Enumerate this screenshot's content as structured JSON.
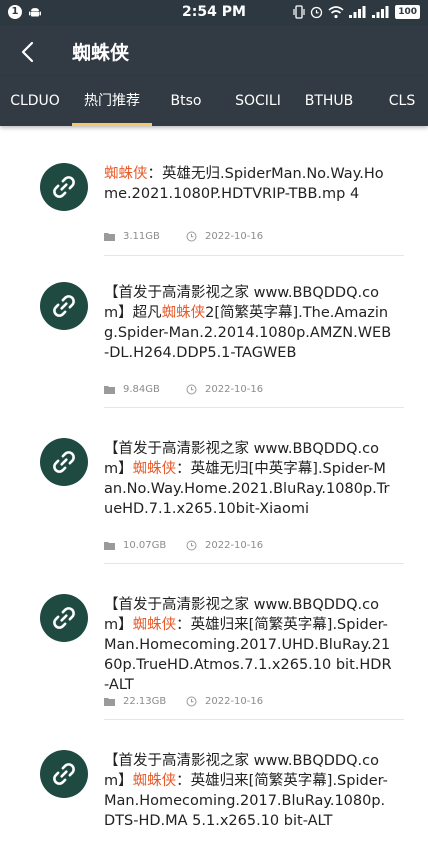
{
  "status_bar": {
    "notification_badge": "1",
    "time": "2:54 PM",
    "battery": "100"
  },
  "header": {
    "title": "蜘蛛侠"
  },
  "tabs": [
    {
      "label": "CLDUO"
    },
    {
      "label": "热门推荐"
    },
    {
      "label": "Btso"
    },
    {
      "label": "SOCILI"
    },
    {
      "label": "BTHUB"
    },
    {
      "label": "CLS"
    }
  ],
  "active_tab": "热门推荐",
  "colors": {
    "app_bar": "#323b43",
    "status_bar": "#2e3840",
    "tab_indicator": "#f3c96a",
    "highlight": "#e85a2a",
    "avatar": "#1f4a41"
  },
  "results": [
    {
      "prefix": "",
      "highlight": "蜘蛛侠",
      "suffix": "：英雄无归.SpiderMan.No.Way.Home.2021.1080P.HDTVRIP-TBB.mp 4",
      "size": "3.11GB",
      "date": "2022-10-16"
    },
    {
      "prefix": "【首发于高清影视之家 www.BBQDDQ.com】超凡",
      "highlight": "蜘蛛侠",
      "suffix": "2[简繁英字幕].The.Amazing.Spider-Man.2.2014.1080p.AMZN.WEB-DL.H264.DDP5.1-TAGWEB",
      "size": "9.84GB",
      "date": "2022-10-16"
    },
    {
      "prefix": "【首发于高清影视之家 www.BBQDDQ.com】",
      "highlight": "蜘蛛侠",
      "suffix": "：英雄无归[中英字幕].Spider-Man.No.Way.Home.2021.BluRay.1080p.TrueHD.7.1.x265.10bit-Xiaomi",
      "size": "10.07GB",
      "date": "2022-10-16"
    },
    {
      "prefix": "【首发于高清影视之家 www.BBQDDQ.com】",
      "highlight": "蜘蛛侠",
      "suffix": "：英雄归来[简繁英字幕].Spider-Man.Homecoming.2017.UHD.BluRay.2160p.TrueHD.Atmos.7.1.x265.10 bit.HDR-ALT",
      "size": "22.13GB",
      "date": "2022-10-16"
    },
    {
      "prefix": "【首发于高清影视之家 www.BBQDDQ.com】",
      "highlight": "蜘蛛侠",
      "suffix": "：英雄归来[简繁英字幕].Spider-Man.Homecoming.2017.BluRay.1080p.DTS-HD.MA 5.1.x265.10 bit-ALT",
      "size": "",
      "date": ""
    }
  ]
}
